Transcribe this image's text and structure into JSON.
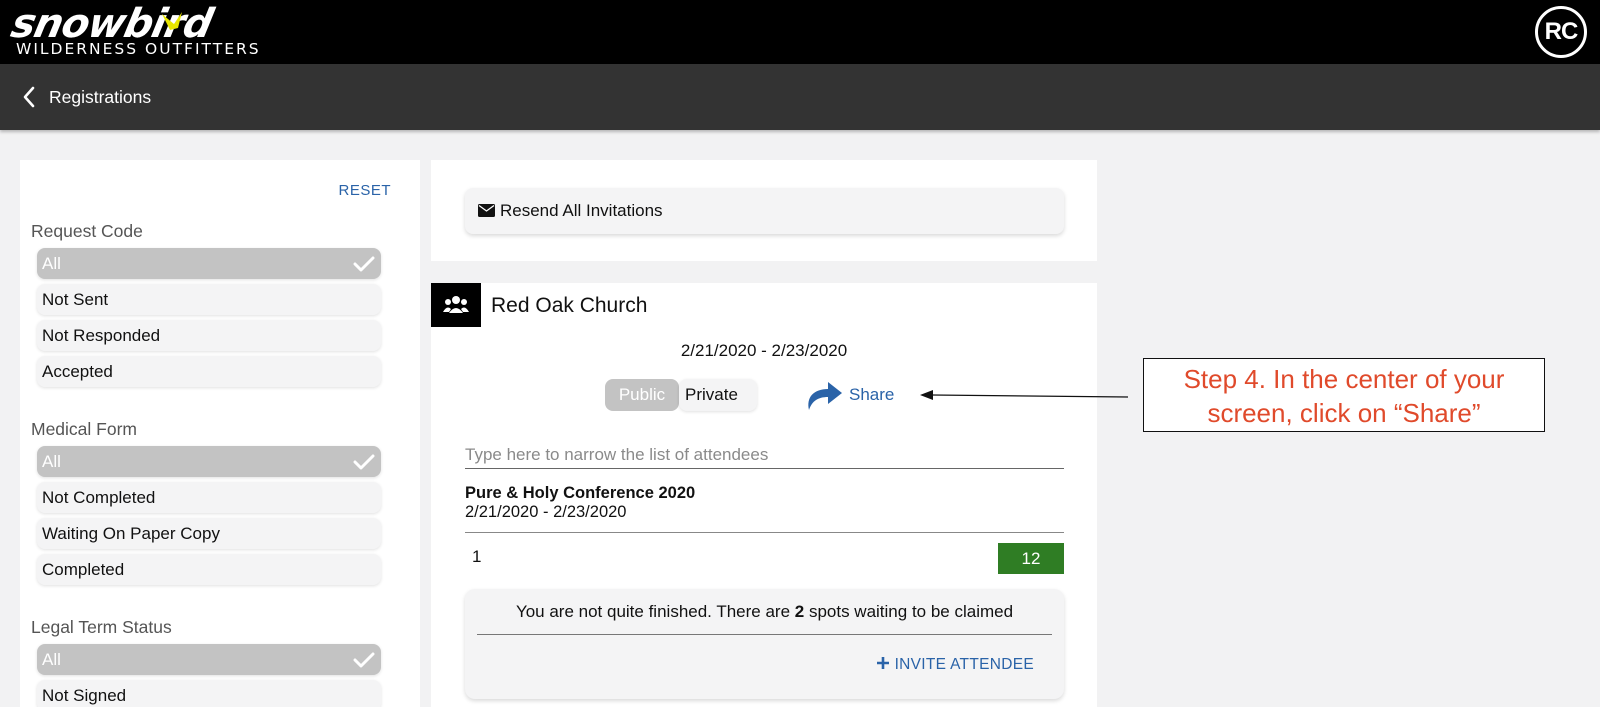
{
  "brand": {
    "logo_word": "snowbird",
    "logo_sub": "WILDERNESS OUTFITTERS",
    "accent_color": "#e8e600"
  },
  "user": {
    "initials": "RC"
  },
  "nav": {
    "title": "Registrations"
  },
  "filters": {
    "reset_label": "RESET",
    "groups": [
      {
        "label": "Request Code",
        "options": [
          "All",
          "Not Sent",
          "Not Responded",
          "Accepted"
        ],
        "selected": "All"
      },
      {
        "label": "Medical Form",
        "options": [
          "All",
          "Not Completed",
          "Waiting On Paper Copy",
          "Completed"
        ],
        "selected": "All"
      },
      {
        "label": "Legal Term Status",
        "options": [
          "All",
          "Not Signed"
        ],
        "selected": "All"
      }
    ]
  },
  "invitations": {
    "resend_label": "Resend All Invitations"
  },
  "registration": {
    "church_name": "Red Oak Church",
    "date_range": "2/21/2020 - 2/23/2020",
    "visibility": {
      "public_label": "Public",
      "private_label": "Private",
      "selected": "Public"
    },
    "share_label": "Share",
    "search_placeholder": "Type here to narrow the list of attendees",
    "event": {
      "name": "Pure & Holy Conference 2020",
      "dates": "2/21/2020 - 2/23/2020"
    },
    "row_number": "1",
    "count": "12",
    "count_color": "#2f7d24",
    "notice": {
      "before": "You are not quite finished. There are ",
      "spots": "2",
      "after": " spots waiting to be claimed"
    },
    "invite_label": "INVITE ATTENDEE"
  },
  "annotation": {
    "line1": "Step 4. In the center of your",
    "line2": "screen, click on “Share”",
    "color": "#e04a2b"
  }
}
